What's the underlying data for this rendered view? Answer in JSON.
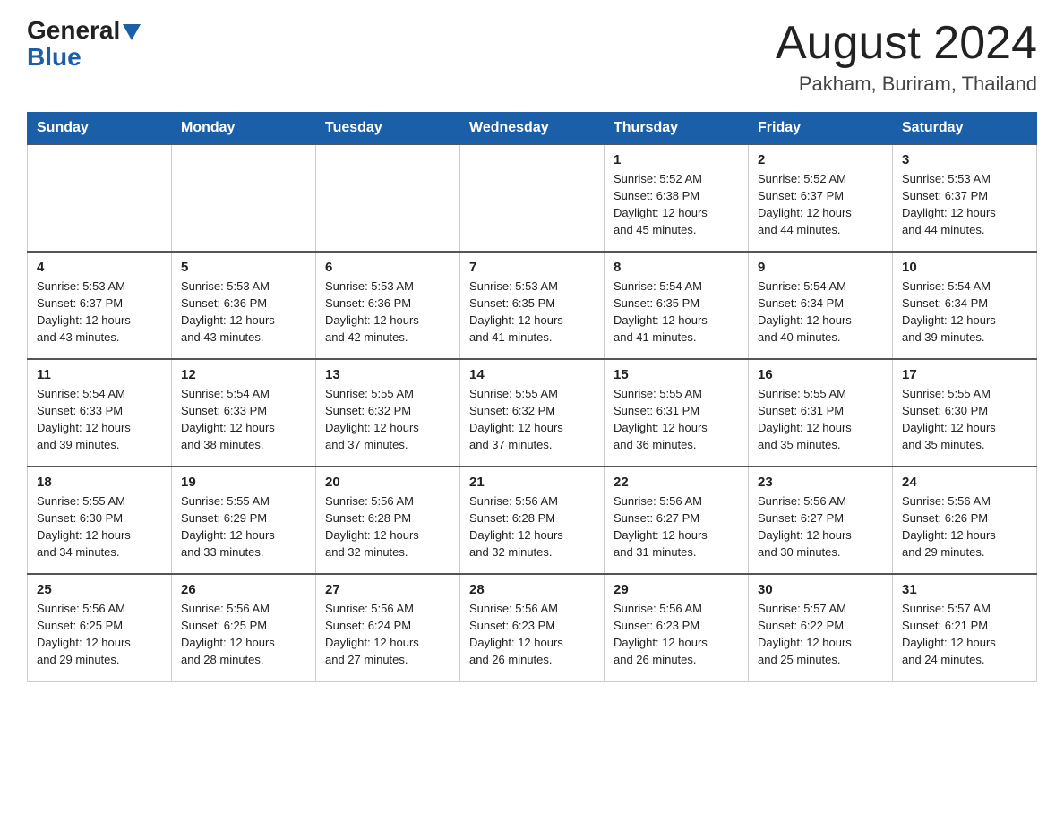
{
  "header": {
    "logo_general": "General",
    "logo_blue": "Blue",
    "title": "August 2024",
    "location": "Pakham, Buriram, Thailand"
  },
  "days_of_week": [
    "Sunday",
    "Monday",
    "Tuesday",
    "Wednesday",
    "Thursday",
    "Friday",
    "Saturday"
  ],
  "weeks": [
    [
      {
        "day": "",
        "info": ""
      },
      {
        "day": "",
        "info": ""
      },
      {
        "day": "",
        "info": ""
      },
      {
        "day": "",
        "info": ""
      },
      {
        "day": "1",
        "info": "Sunrise: 5:52 AM\nSunset: 6:38 PM\nDaylight: 12 hours\nand 45 minutes."
      },
      {
        "day": "2",
        "info": "Sunrise: 5:52 AM\nSunset: 6:37 PM\nDaylight: 12 hours\nand 44 minutes."
      },
      {
        "day": "3",
        "info": "Sunrise: 5:53 AM\nSunset: 6:37 PM\nDaylight: 12 hours\nand 44 minutes."
      }
    ],
    [
      {
        "day": "4",
        "info": "Sunrise: 5:53 AM\nSunset: 6:37 PM\nDaylight: 12 hours\nand 43 minutes."
      },
      {
        "day": "5",
        "info": "Sunrise: 5:53 AM\nSunset: 6:36 PM\nDaylight: 12 hours\nand 43 minutes."
      },
      {
        "day": "6",
        "info": "Sunrise: 5:53 AM\nSunset: 6:36 PM\nDaylight: 12 hours\nand 42 minutes."
      },
      {
        "day": "7",
        "info": "Sunrise: 5:53 AM\nSunset: 6:35 PM\nDaylight: 12 hours\nand 41 minutes."
      },
      {
        "day": "8",
        "info": "Sunrise: 5:54 AM\nSunset: 6:35 PM\nDaylight: 12 hours\nand 41 minutes."
      },
      {
        "day": "9",
        "info": "Sunrise: 5:54 AM\nSunset: 6:34 PM\nDaylight: 12 hours\nand 40 minutes."
      },
      {
        "day": "10",
        "info": "Sunrise: 5:54 AM\nSunset: 6:34 PM\nDaylight: 12 hours\nand 39 minutes."
      }
    ],
    [
      {
        "day": "11",
        "info": "Sunrise: 5:54 AM\nSunset: 6:33 PM\nDaylight: 12 hours\nand 39 minutes."
      },
      {
        "day": "12",
        "info": "Sunrise: 5:54 AM\nSunset: 6:33 PM\nDaylight: 12 hours\nand 38 minutes."
      },
      {
        "day": "13",
        "info": "Sunrise: 5:55 AM\nSunset: 6:32 PM\nDaylight: 12 hours\nand 37 minutes."
      },
      {
        "day": "14",
        "info": "Sunrise: 5:55 AM\nSunset: 6:32 PM\nDaylight: 12 hours\nand 37 minutes."
      },
      {
        "day": "15",
        "info": "Sunrise: 5:55 AM\nSunset: 6:31 PM\nDaylight: 12 hours\nand 36 minutes."
      },
      {
        "day": "16",
        "info": "Sunrise: 5:55 AM\nSunset: 6:31 PM\nDaylight: 12 hours\nand 35 minutes."
      },
      {
        "day": "17",
        "info": "Sunrise: 5:55 AM\nSunset: 6:30 PM\nDaylight: 12 hours\nand 35 minutes."
      }
    ],
    [
      {
        "day": "18",
        "info": "Sunrise: 5:55 AM\nSunset: 6:30 PM\nDaylight: 12 hours\nand 34 minutes."
      },
      {
        "day": "19",
        "info": "Sunrise: 5:55 AM\nSunset: 6:29 PM\nDaylight: 12 hours\nand 33 minutes."
      },
      {
        "day": "20",
        "info": "Sunrise: 5:56 AM\nSunset: 6:28 PM\nDaylight: 12 hours\nand 32 minutes."
      },
      {
        "day": "21",
        "info": "Sunrise: 5:56 AM\nSunset: 6:28 PM\nDaylight: 12 hours\nand 32 minutes."
      },
      {
        "day": "22",
        "info": "Sunrise: 5:56 AM\nSunset: 6:27 PM\nDaylight: 12 hours\nand 31 minutes."
      },
      {
        "day": "23",
        "info": "Sunrise: 5:56 AM\nSunset: 6:27 PM\nDaylight: 12 hours\nand 30 minutes."
      },
      {
        "day": "24",
        "info": "Sunrise: 5:56 AM\nSunset: 6:26 PM\nDaylight: 12 hours\nand 29 minutes."
      }
    ],
    [
      {
        "day": "25",
        "info": "Sunrise: 5:56 AM\nSunset: 6:25 PM\nDaylight: 12 hours\nand 29 minutes."
      },
      {
        "day": "26",
        "info": "Sunrise: 5:56 AM\nSunset: 6:25 PM\nDaylight: 12 hours\nand 28 minutes."
      },
      {
        "day": "27",
        "info": "Sunrise: 5:56 AM\nSunset: 6:24 PM\nDaylight: 12 hours\nand 27 minutes."
      },
      {
        "day": "28",
        "info": "Sunrise: 5:56 AM\nSunset: 6:23 PM\nDaylight: 12 hours\nand 26 minutes."
      },
      {
        "day": "29",
        "info": "Sunrise: 5:56 AM\nSunset: 6:23 PM\nDaylight: 12 hours\nand 26 minutes."
      },
      {
        "day": "30",
        "info": "Sunrise: 5:57 AM\nSunset: 6:22 PM\nDaylight: 12 hours\nand 25 minutes."
      },
      {
        "day": "31",
        "info": "Sunrise: 5:57 AM\nSunset: 6:21 PM\nDaylight: 12 hours\nand 24 minutes."
      }
    ]
  ]
}
